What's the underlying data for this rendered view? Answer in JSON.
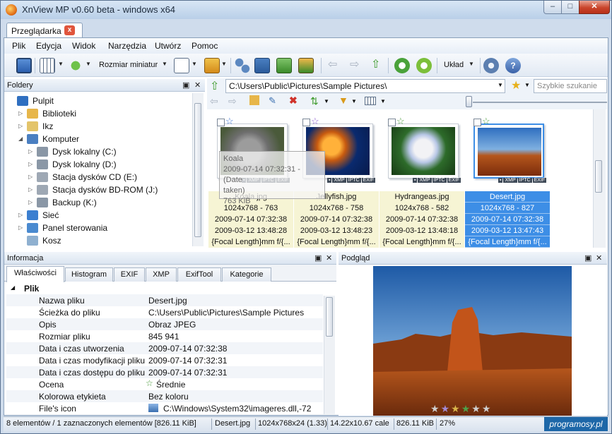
{
  "window": {
    "title": "XnView MP v0.60 beta - windows x64",
    "min": "–",
    "max": "□",
    "close": "✕"
  },
  "tab": {
    "label": "Przeglądarka",
    "close": "x"
  },
  "menu": [
    "Plik",
    "Edycja",
    "Widok",
    "Narzędzia",
    "Utwórz",
    "Pomoc"
  ],
  "toolbar": {
    "thumbnail_size_label": "Rozmiar miniatur",
    "layout_label": "Układ"
  },
  "folders": {
    "title": "Foldery",
    "items": [
      {
        "label": "Pulpit",
        "icon": "desktop-icon",
        "arrow": "",
        "color": "#2f6fc0"
      },
      {
        "label": "Biblioteki",
        "icon": "library-icon",
        "arrow": "▷",
        "color": "#e7b64a"
      },
      {
        "label": "Ikz",
        "icon": "user-folder-icon",
        "arrow": "▷",
        "color": "#e3c46a"
      },
      {
        "label": "Komputer",
        "icon": "computer-icon",
        "arrow": "◢",
        "color": "#4a7fc1"
      },
      {
        "label": "Dysk lokalny (C:)",
        "icon": "drive-icon",
        "arrow": "▷",
        "color": "#8a97a6"
      },
      {
        "label": "Dysk lokalny (D:)",
        "icon": "drive-icon",
        "arrow": "▷",
        "color": "#8a97a6"
      },
      {
        "label": "Stacja dysków CD (E:)",
        "icon": "cd-drive-icon",
        "arrow": "▷",
        "color": "#9ea8b4"
      },
      {
        "label": "Stacja dysków BD-ROM (J:)",
        "icon": "bd-drive-icon",
        "arrow": "▷",
        "color": "#9ea8b4"
      },
      {
        "label": "Backup (K:)",
        "icon": "drive-icon",
        "arrow": "▷",
        "color": "#8a97a6"
      },
      {
        "label": "Sieć",
        "icon": "network-icon",
        "arrow": "▷",
        "color": "#3c7fd0"
      },
      {
        "label": "Panel sterowania",
        "icon": "control-panel-icon",
        "arrow": "▷",
        "color": "#4a8ad0"
      },
      {
        "label": "Kosz",
        "icon": "recycle-bin-icon",
        "arrow": "",
        "color": "#8fb0d0"
      }
    ]
  },
  "browser": {
    "path": "C:\\Users\\Public\\Pictures\\Sample Pictures\\",
    "search_placeholder": "Szybkie szukanie",
    "thumbs": [
      {
        "name": "Koala.jpg",
        "dims": "1024x768 - 763",
        "date1": "2009-07-14 07:32:38",
        "date2": "2009-03-12 13:48:28",
        "exif": "{Focal Length}mm f/{...",
        "star_color": "#3a72d0",
        "selected": false
      },
      {
        "name": "Jellyfish.jpg",
        "dims": "1024x768 - 758",
        "date1": "2009-07-14 07:32:38",
        "date2": "2009-03-12 13:48:23",
        "exif": "{Focal Length}mm f/{...",
        "star_color": "#8a5ad0",
        "selected": false
      },
      {
        "name": "Hydrangeas.jpg",
        "dims": "1024x768 - 582",
        "date1": "2009-07-14 07:32:38",
        "date2": "2009-03-12 13:48:18",
        "exif": "{Focal Length}mm f/{...",
        "star_color": "#4a9a3a",
        "selected": false
      },
      {
        "name": "Desert.jpg",
        "dims": "1024x768 - 827",
        "date1": "2009-07-14 07:32:38",
        "date2": "2009-03-12 13:47:43",
        "exif": "{Focal Length}mm f/{...",
        "star_color": "#4a9a3a",
        "selected": true
      }
    ],
    "badges": [
      "XMP",
      "IPTC",
      "EXIF"
    ],
    "tooltip": [
      "Koala",
      "2009-07-14 07:32:31 - (Date",
      "taken)",
      "763 KiB"
    ]
  },
  "info": {
    "title": "Informacja",
    "tabs": [
      "Właściwości",
      "Histogram",
      "EXIF",
      "XMP",
      "ExifTool",
      "Kategorie"
    ],
    "section": "Plik",
    "rows": [
      {
        "k": "Nazwa pliku",
        "v": "Desert.jpg"
      },
      {
        "k": "Ścieżka do pliku",
        "v": "C:\\Users\\Public\\Pictures\\Sample Pictures"
      },
      {
        "k": "Opis",
        "v": "Obraz JPEG"
      },
      {
        "k": "Rozmiar pliku",
        "v": "845 941"
      },
      {
        "k": "Data i czas utworzenia",
        "v": "2009-07-14 07:32:38"
      },
      {
        "k": "Data i czas modyfikacji pliku",
        "v": "2009-07-14 07:32:31"
      },
      {
        "k": "Data i czas dostępu do pliku",
        "v": "2009-07-14 07:32:31"
      },
      {
        "k": "Ocena",
        "v": "Średnie"
      },
      {
        "k": "Kolorowa etykieta",
        "v": "Bez koloru"
      },
      {
        "k": "File's icon",
        "v": "C:\\Windows\\System32\\imageres.dll,-72"
      }
    ]
  },
  "preview": {
    "title": "Podgląd",
    "rating_star_colors": [
      "#cfcfcf",
      "#a38ad6",
      "#d9b64a",
      "#4fa24a",
      "#cfcfcf",
      "#cfcfcf"
    ]
  },
  "status": {
    "count": "8 elementów / 1 zaznaczonych elementów [826.11 KiB]",
    "file": "Desert.jpg",
    "dims": "1024x768x24 (1.33)",
    "size_cm": "14.22x10.67 cale",
    "size": "826.11 KiB",
    "zoom": "27%"
  },
  "watermark": "programosy.pl"
}
